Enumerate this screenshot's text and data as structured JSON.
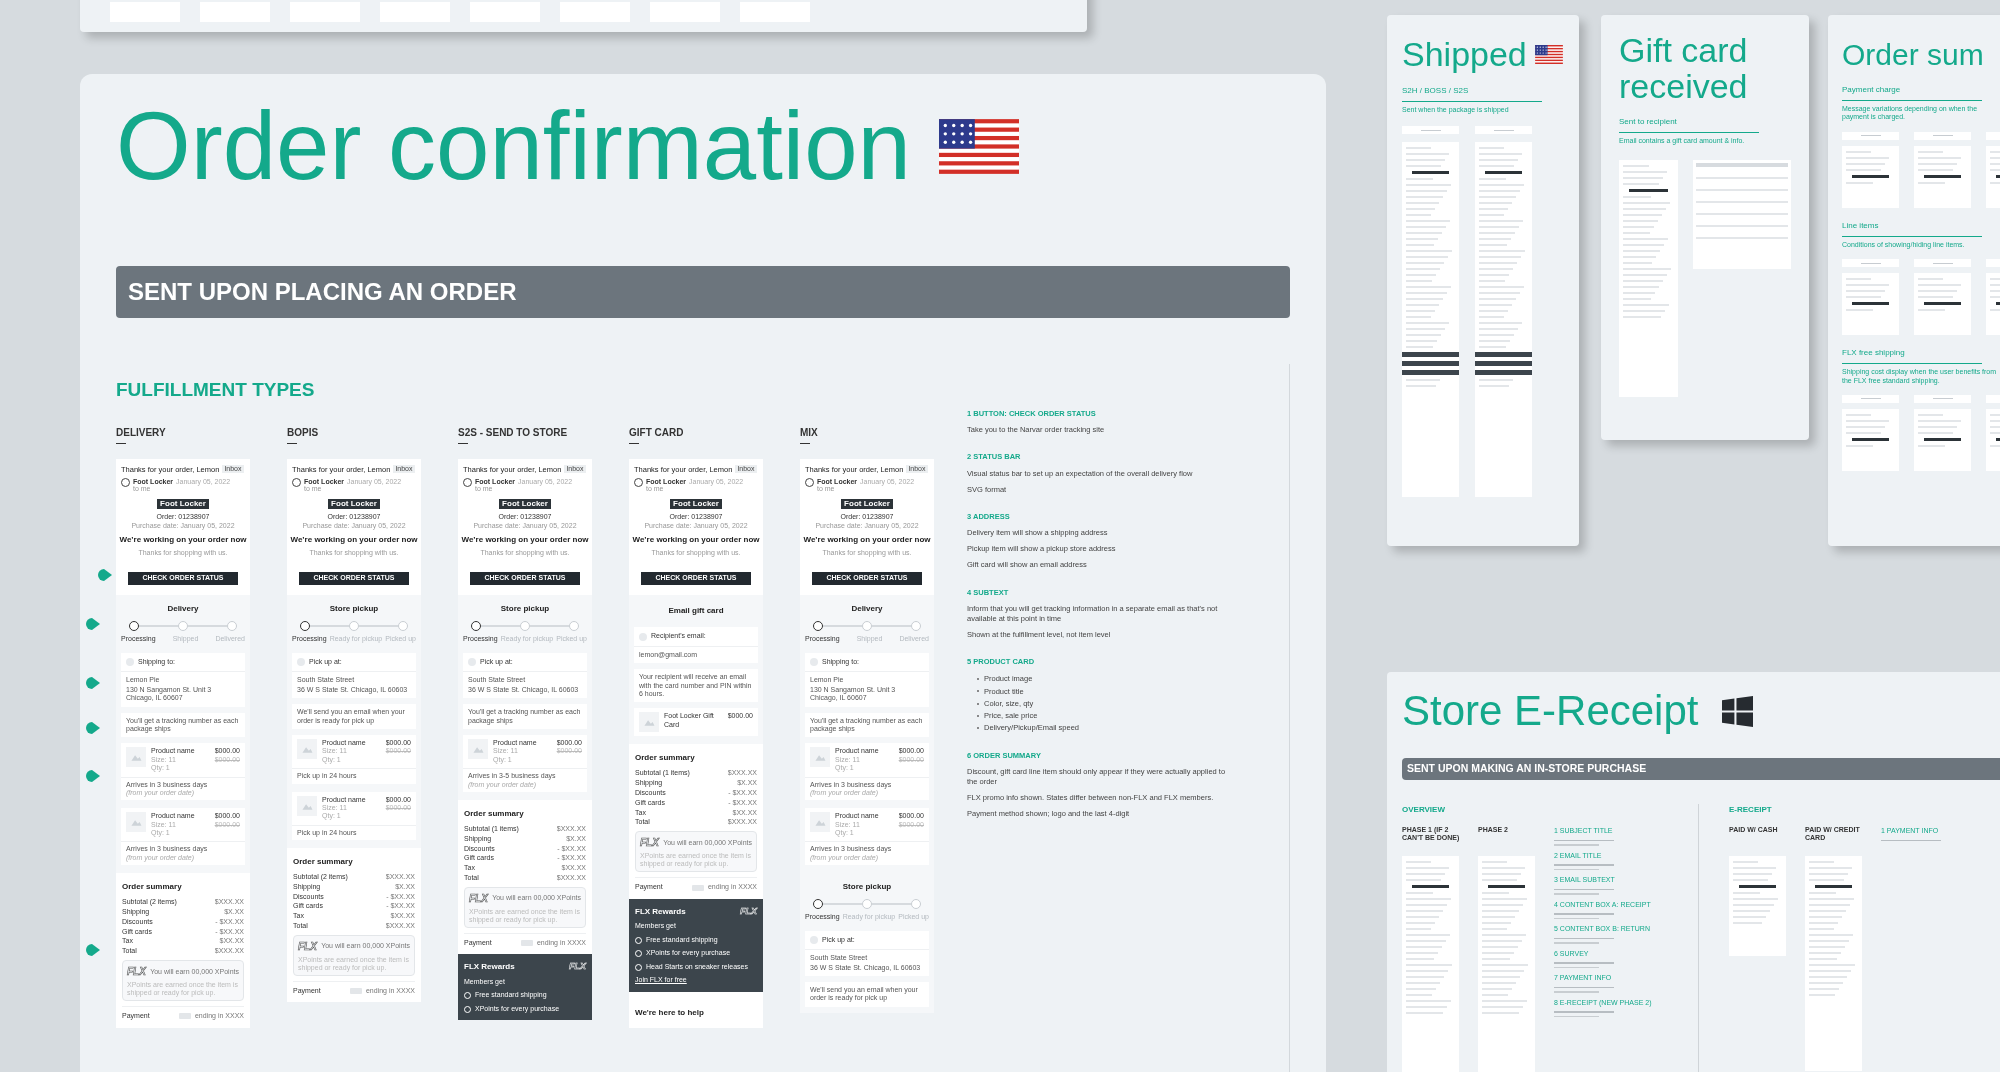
{
  "order_confirmation": {
    "title": "Order confirmation",
    "banner": "SENT UPON PLACING AN ORDER",
    "section_title": "FULFILLMENT TYPES",
    "columns": [
      {
        "heading": "DELIVERY",
        "email": {
          "subject": "Thanks for your order, Lemon",
          "badge": "Inbox",
          "sender": "Foot Locker",
          "date": "January 05, 2022",
          "to": "to me",
          "logo": "Foot Locker",
          "order": "Order: 01238907",
          "purchase_date": "Purchase date: January 05, 2022",
          "headline": "We’re working on your order now",
          "thanks": "Thanks for shopping with us.",
          "button": "CHECK ORDER STATUS",
          "sections": [
            {
              "kind": "status",
              "title": "Delivery",
              "steps": [
                {
                  "label": "Processing",
                  "selected": true
                },
                {
                  "label": "Shipped",
                  "selected": false
                },
                {
                  "label": "Delivered",
                  "selected": false
                }
              ]
            },
            {
              "kind": "address",
              "label": "Shipping to:",
              "lines": [
                "Lemon Pie",
                "130 N Sangamon St. Unit 3 Chicago, IL 60607"
              ]
            },
            {
              "kind": "note",
              "text": "You'll get a tracking number as each package ships"
            },
            {
              "kind": "product",
              "name": "Product name",
              "price": "$000.00",
              "original": "$000.00",
              "size": "Size: 11",
              "qty": "Qty: 1",
              "eta": "Arrives in 3 business days",
              "eta_note": "(from your order date)"
            },
            {
              "kind": "product",
              "name": "Product name",
              "price": "$000.00",
              "original": "$000.00",
              "size": "Size: 11",
              "qty": "Qty: 1",
              "eta": "Arrives in 3 business days",
              "eta_note": "(from your order date)"
            },
            {
              "kind": "summary",
              "title": "Order summary",
              "rows": [
                {
                  "label": "Subtotal (2 items)",
                  "value": "$XXX.XX"
                },
                {
                  "label": "Shipping",
                  "value": "$X.XX"
                },
                {
                  "label": "Discounts",
                  "value": "- $XX.XX"
                },
                {
                  "label": "Gift cards",
                  "value": "- $XX.XX"
                },
                {
                  "label": "Tax",
                  "value": "$XX.XX"
                },
                {
                  "label": "Total",
                  "value": "$XXX.XX"
                }
              ],
              "flx": "FLX",
              "points": "You will earn 00,000 XPoints",
              "points_note": "XPoints are earned once the item is shipped or ready for pick up.",
              "payment": "Payment",
              "card": "ending in XXXX"
            }
          ]
        }
      },
      {
        "heading": "BOPIS",
        "email": {
          "subject": "Thanks for your order, Lemon",
          "badge": "Inbox",
          "sender": "Foot Locker",
          "date": "January 05, 2022",
          "to": "to me",
          "logo": "Foot Locker",
          "order": "Order: 01238907",
          "purchase_date": "Purchase date: January 05, 2022",
          "headline": "We’re working on your order now",
          "thanks": "Thanks for shopping with us.",
          "button": "CHECK ORDER STATUS",
          "sections": [
            {
              "kind": "status",
              "title": "Store pickup",
              "steps": [
                {
                  "label": "Processing",
                  "selected": true
                },
                {
                  "label": "Ready for pickup",
                  "selected": false
                },
                {
                  "label": "Picked up",
                  "selected": false
                }
              ]
            },
            {
              "kind": "address",
              "label": "Pick up at:",
              "lines": [
                "South State Street",
                "36 W S State St. Chicago, IL 60603"
              ]
            },
            {
              "kind": "note",
              "text": "We'll send you an email when your order is ready for pick up"
            },
            {
              "kind": "product",
              "name": "Product name",
              "price": "$000.00",
              "original": "$000.00",
              "size": "Size: 11",
              "qty": "Qty: 1",
              "eta": "Pick up in 24 hours"
            },
            {
              "kind": "product",
              "name": "Product name",
              "price": "$000.00",
              "original": "$000.00",
              "size": "Size: 11",
              "qty": "Qty: 1",
              "eta": "Pick up in 24 hours"
            },
            {
              "kind": "summary",
              "title": "Order summary",
              "rows": [
                {
                  "label": "Subtotal (2 items)",
                  "value": "$XXX.XX"
                },
                {
                  "label": "Shipping",
                  "value": "$X.XX"
                },
                {
                  "label": "Discounts",
                  "value": "- $XX.XX"
                },
                {
                  "label": "Gift cards",
                  "value": "- $XX.XX"
                },
                {
                  "label": "Tax",
                  "value": "$XX.XX"
                },
                {
                  "label": "Total",
                  "value": "$XXX.XX"
                }
              ],
              "flx": "FLX",
              "points": "You will earn 00,000 XPoints",
              "points_note": "XPoints are earned once the item is shipped or ready for pick up.",
              "payment": "Payment",
              "card": "ending in XXXX"
            }
          ]
        }
      },
      {
        "heading": "S2S - SEND TO STORE",
        "email": {
          "subject": "Thanks for your order, Lemon",
          "badge": "Inbox",
          "sender": "Foot Locker",
          "date": "January 05, 2022",
          "to": "to me",
          "logo": "Foot Locker",
          "order": "Order: 01238907",
          "purchase_date": "Purchase date: January 05, 2022",
          "headline": "We’re working on your order now",
          "thanks": "Thanks for shopping with us.",
          "button": "CHECK ORDER STATUS",
          "sections": [
            {
              "kind": "status",
              "title": "Store pickup",
              "steps": [
                {
                  "label": "Processing",
                  "selected": true
                },
                {
                  "label": "Ready for pickup",
                  "selected": false
                },
                {
                  "label": "Picked up",
                  "selected": false
                }
              ]
            },
            {
              "kind": "address",
              "label": "Pick up at:",
              "lines": [
                "South State Street",
                "36 W S State St. Chicago, IL 60603"
              ]
            },
            {
              "kind": "note",
              "text": "You'll get a tracking number as each package ships"
            },
            {
              "kind": "product",
              "name": "Product name",
              "price": "$000.00",
              "original": "$000.00",
              "size": "Size: 11",
              "qty": "Qty: 1",
              "eta": "Arrives in 3-5 business days",
              "eta_note": "(from your order date)"
            },
            {
              "kind": "summary",
              "title": "Order summary",
              "rows": [
                {
                  "label": "Subtotal (1 items)",
                  "value": "$XXX.XX"
                },
                {
                  "label": "Shipping",
                  "value": "$X.XX"
                },
                {
                  "label": "Discounts",
                  "value": "- $XX.XX"
                },
                {
                  "label": "Gift cards",
                  "value": "- $XX.XX"
                },
                {
                  "label": "Tax",
                  "value": "$XX.XX"
                },
                {
                  "label": "Total",
                  "value": "$XXX.XX"
                }
              ],
              "flx": "FLX",
              "points": "You will earn 00,000 XPoints",
              "points_note": "XPoints are earned once the item is shipped or ready for pick up.",
              "payment": "Payment",
              "card": "ending in XXXX"
            },
            {
              "kind": "rewards",
              "title": "FLX Rewards",
              "logo": "FLX",
              "sub": "Members get",
              "perks": [
                "Free standard shipping",
                "XPoints for every purchase"
              ]
            }
          ]
        }
      },
      {
        "heading": "GIFT CARD",
        "email": {
          "subject": "Thanks for your order, Lemon",
          "badge": "Inbox",
          "sender": "Foot Locker",
          "date": "January 05, 2022",
          "to": "to me",
          "logo": "Foot Locker",
          "order": "Order: 01238907",
          "purchase_date": "Purchase date: January 05, 2022",
          "headline": "We’re working on your order now",
          "thanks": "Thanks for shopping with us.",
          "button": "CHECK ORDER STATUS",
          "sections": [
            {
              "kind": "gift",
              "title": "Email gift card"
            },
            {
              "kind": "address",
              "label": "Recipient's email:",
              "lines": [
                "lemon@gmail.com"
              ]
            },
            {
              "kind": "note",
              "text": "Your recipient will receive an email with the card number and PIN within 6 hours."
            },
            {
              "kind": "product",
              "name": "Foot Locker Gift Card",
              "price": "$000.00"
            },
            {
              "kind": "summary",
              "title": "Order summary",
              "rows": [
                {
                  "label": "Subtotal (1 items)",
                  "value": "$XXX.XX"
                },
                {
                  "label": "Shipping",
                  "value": "$X.XX"
                },
                {
                  "label": "Discounts",
                  "value": "- $XX.XX"
                },
                {
                  "label": "Gift cards",
                  "value": "- $XX.XX"
                },
                {
                  "label": "Tax",
                  "value": "$XX.XX"
                },
                {
                  "label": "Total",
                  "value": "$XXX.XX"
                }
              ],
              "flx": "FLX",
              "points": "You will earn 00,000 XPoints",
              "points_note": "XPoints are earned once the item is shipped or ready for pick up.",
              "payment": "Payment",
              "card": "ending in XXXX"
            },
            {
              "kind": "rewards",
              "title": "FLX Rewards",
              "logo": "FLX",
              "sub": "Members get",
              "perks": [
                "Free standard shipping",
                "XPoints for every purchase",
                "Head Starts on sneaker releases"
              ],
              "link": "Join FLX for free"
            },
            {
              "kind": "help",
              "title": "We're here to help"
            }
          ]
        }
      },
      {
        "heading": "MIX",
        "email": {
          "subject": "Thanks for your order, Lemon",
          "badge": "Inbox",
          "sender": "Foot Locker",
          "date": "January 05, 2022",
          "to": "to me",
          "logo": "Foot Locker",
          "order": "Order: 01238907",
          "purchase_date": "Purchase date: January 05, 2022",
          "headline": "We’re working on your order now",
          "thanks": "Thanks for shopping with us.",
          "button": "CHECK ORDER STATUS",
          "sections": [
            {
              "kind": "status",
              "title": "Delivery",
              "steps": [
                {
                  "label": "Processing",
                  "selected": true
                },
                {
                  "label": "Shipped",
                  "selected": false
                },
                {
                  "label": "Delivered",
                  "selected": false
                }
              ]
            },
            {
              "kind": "address",
              "label": "Shipping to:",
              "lines": [
                "Lemon Pie",
                "130 N Sangamon St. Unit 3 Chicago, IL 60607"
              ]
            },
            {
              "kind": "note",
              "text": "You'll get a tracking number as each package ships"
            },
            {
              "kind": "product",
              "name": "Product name",
              "price": "$000.00",
              "original": "$000.00",
              "size": "Size: 11",
              "qty": "Qty: 1",
              "eta": "Arrives in 3 business days",
              "eta_note": "(from your order date)"
            },
            {
              "kind": "product",
              "name": "Product name",
              "price": "$000.00",
              "original": "$000.00",
              "size": "Size: 11",
              "qty": "Qty: 1",
              "eta": "Arrives in 3 business days",
              "eta_note": "(from your order date)"
            },
            {
              "kind": "status",
              "title": "Store pickup",
              "steps": [
                {
                  "label": "Processing",
                  "selected": true
                },
                {
                  "label": "Ready for pickup",
                  "selected": false
                },
                {
                  "label": "Picked up",
                  "selected": false
                }
              ]
            },
            {
              "kind": "address",
              "label": "Pick up at:",
              "lines": [
                "South State Street",
                "36 W S State St. Chicago, IL 60603"
              ]
            },
            {
              "kind": "note",
              "text": "We'll send you an email when your order is ready for pick up"
            }
          ]
        }
      }
    ],
    "notes": [
      {
        "heading": "1 BUTTON: CHECK ORDER STATUS",
        "paragraphs": [
          "Take you to the Narvar order tracking site"
        ]
      },
      {
        "heading": "2 STATUS BAR",
        "paragraphs": [
          "Visual status bar to set up an expectation of the overall delivery flow",
          "SVG format"
        ]
      },
      {
        "heading": "3 ADDRESS",
        "paragraphs": [
          "Delivery item will show a shipping address",
          "Pickup item will show a pickup store address",
          "Gift card will show an email address"
        ]
      },
      {
        "heading": "4 SUBTEXT",
        "paragraphs": [
          "Inform that you will get tracking information in a separate email as that's not available at this point in time",
          "Shown at the fulfillment level, not item level"
        ]
      },
      {
        "heading": "5 PRODUCT CARD",
        "bullets": [
          "Product image",
          "Product title",
          "Color, size, qty",
          "Price, sale price",
          "Delivery/Pickup/Email speed"
        ]
      },
      {
        "heading": "6 ORDER SUMMARY",
        "paragraphs": [
          "Discount, gift card line item should only appear if they were actually applied to the order",
          "FLX promo info shown. States differ between non-FLX and FLX members.",
          "Payment method shown; logo and the last 4-digit"
        ]
      }
    ]
  },
  "boards": [
    {
      "kind": "shipped",
      "title": "Shipped",
      "sections": [
        {
          "heading": "S2H / BOSS / S2S",
          "caption": "Sent when the package is shipped"
        }
      ]
    },
    {
      "kind": "gift",
      "title": "Gift card received",
      "sections": [
        {
          "heading": "Sent to recipient",
          "caption": "Email contains a gift card amount & info."
        }
      ]
    },
    {
      "kind": "summary",
      "title": "Order sum",
      "sections": [
        {
          "heading": "Payment charge",
          "caption": "Message variations depending on when the payment is charged."
        },
        {
          "heading": "Line items",
          "caption": "Conditions of showing/hiding line items."
        },
        {
          "heading": "FLX free shipping",
          "caption": "Shipping cost display when the user benefits from the FLX free standard shipping."
        }
      ]
    }
  ],
  "store_receipt": {
    "title": "Store E-Receipt",
    "banner": "SENT UPON MAKING AN IN-STORE PURCHASE",
    "groups": [
      {
        "heading": "OVERVIEW",
        "phases": [
          "PHASE 1 (IF 2 CAN'T BE DONE)",
          "PHASE 2"
        ],
        "notes": [
          "1 SUBJECT TITLE",
          "2 EMAIL TITLE",
          "3 EMAIL SUBTEXT",
          "4 CONTENT BOX A: RECEIPT",
          "5 CONTENT BOX B: RETURN",
          "6 SURVEY",
          "7 PAYMENT INFO",
          "8 E-RECEIPT (NEW PHASE 2)"
        ]
      },
      {
        "heading": "E-RECEIPT",
        "phases": [
          "PAID W/ CASH",
          "PAID W/ CREDIT CARD"
        ],
        "notes": [
          "1 PAYMENT INFO"
        ]
      }
    ]
  }
}
